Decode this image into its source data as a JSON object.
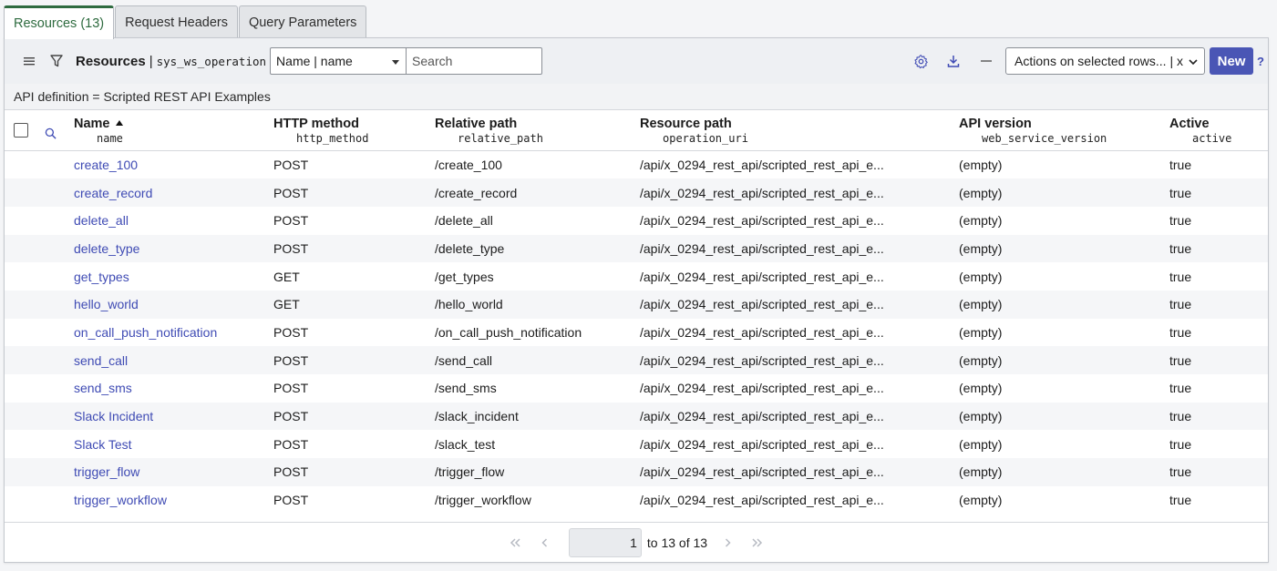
{
  "tabs": [
    {
      "label": "Resources (13)"
    },
    {
      "label": "Request Headers"
    },
    {
      "label": "Query Parameters"
    }
  ],
  "toolbar": {
    "title": "Resources",
    "separator": "|",
    "table_name": "sys_ws_operation",
    "field_select_value": "Name | name",
    "search_placeholder": "Search",
    "actions_label": "Actions on selected rows... | x",
    "new_label": "New",
    "help_label": "?"
  },
  "breadcrumb": "API definition = Scripted REST API Examples",
  "columns": [
    {
      "label": "Name",
      "field": "name",
      "sorted": "asc"
    },
    {
      "label": "HTTP method",
      "field": "http_method"
    },
    {
      "label": "Relative path",
      "field": "relative_path"
    },
    {
      "label": "Resource path",
      "field": "operation_uri"
    },
    {
      "label": "API version",
      "field": "web_service_version"
    },
    {
      "label": "Active",
      "field": "active"
    }
  ],
  "rows": [
    {
      "name": "create_100",
      "method": "POST",
      "path": "/create_100",
      "uri": "/api/x_0294_rest_api/scripted_rest_api_e...",
      "version": "(empty)",
      "active": "true"
    },
    {
      "name": "create_record",
      "method": "POST",
      "path": "/create_record",
      "uri": "/api/x_0294_rest_api/scripted_rest_api_e...",
      "version": "(empty)",
      "active": "true"
    },
    {
      "name": "delete_all",
      "method": "POST",
      "path": "/delete_all",
      "uri": "/api/x_0294_rest_api/scripted_rest_api_e...",
      "version": "(empty)",
      "active": "true"
    },
    {
      "name": "delete_type",
      "method": "POST",
      "path": "/delete_type",
      "uri": "/api/x_0294_rest_api/scripted_rest_api_e...",
      "version": "(empty)",
      "active": "true"
    },
    {
      "name": "get_types",
      "method": "GET",
      "path": "/get_types",
      "uri": "/api/x_0294_rest_api/scripted_rest_api_e...",
      "version": "(empty)",
      "active": "true"
    },
    {
      "name": "hello_world",
      "method": "GET",
      "path": "/hello_world",
      "uri": "/api/x_0294_rest_api/scripted_rest_api_e...",
      "version": "(empty)",
      "active": "true"
    },
    {
      "name": "on_call_push_notification",
      "method": "POST",
      "path": "/on_call_push_notification",
      "uri": "/api/x_0294_rest_api/scripted_rest_api_e...",
      "version": "(empty)",
      "active": "true"
    },
    {
      "name": "send_call",
      "method": "POST",
      "path": "/send_call",
      "uri": "/api/x_0294_rest_api/scripted_rest_api_e...",
      "version": "(empty)",
      "active": "true"
    },
    {
      "name": "send_sms",
      "method": "POST",
      "path": "/send_sms",
      "uri": "/api/x_0294_rest_api/scripted_rest_api_e...",
      "version": "(empty)",
      "active": "true"
    },
    {
      "name": "Slack Incident",
      "method": "POST",
      "path": "/slack_incident",
      "uri": "/api/x_0294_rest_api/scripted_rest_api_e...",
      "version": "(empty)",
      "active": "true"
    },
    {
      "name": "Slack Test",
      "method": "POST",
      "path": "/slack_test",
      "uri": "/api/x_0294_rest_api/scripted_rest_api_e...",
      "version": "(empty)",
      "active": "true"
    },
    {
      "name": "trigger_flow",
      "method": "POST",
      "path": "/trigger_flow",
      "uri": "/api/x_0294_rest_api/scripted_rest_api_e...",
      "version": "(empty)",
      "active": "true"
    },
    {
      "name": "trigger_workflow",
      "method": "POST",
      "path": "/trigger_workflow",
      "uri": "/api/x_0294_rest_api/scripted_rest_api_e...",
      "version": "(empty)",
      "active": "true"
    }
  ],
  "pager": {
    "current": "1",
    "range_text": "to 13 of 13"
  },
  "colors": {
    "accent": "#4a56b5",
    "link": "#3f4bb4",
    "active_tab": "#2e6b3f"
  },
  "icons": {
    "menu": "hamburger-menu-icon",
    "filter": "filter-icon",
    "settings": "gear-icon",
    "download": "download-icon",
    "collapse": "minus-icon",
    "search": "search-icon"
  }
}
